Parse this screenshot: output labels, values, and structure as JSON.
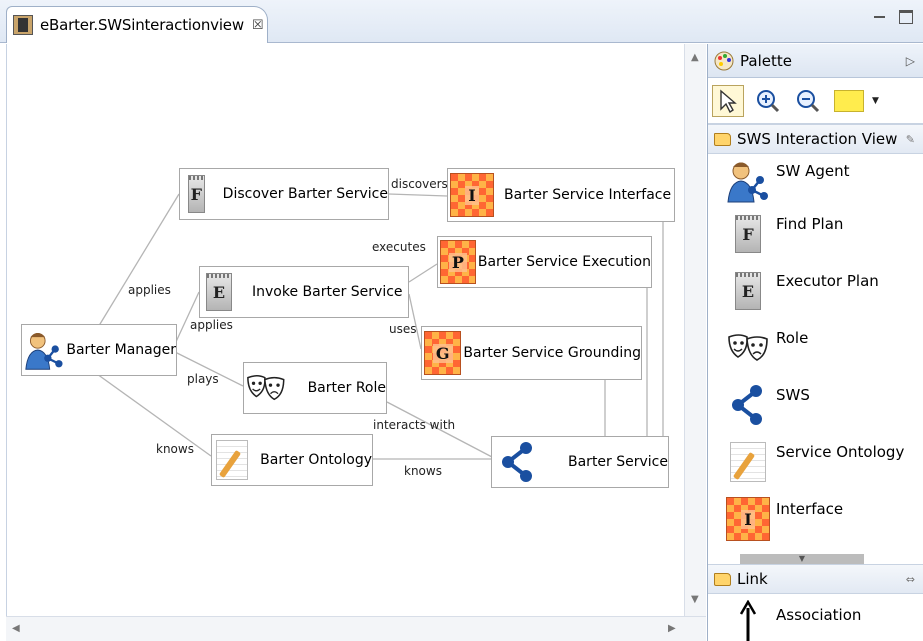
{
  "editor": {
    "tab_title": "eBarter.SWSinteractionview",
    "tab_close": "☒"
  },
  "diagram": {
    "nodes": {
      "barter_manager": "Barter Manager",
      "discover": "Discover Barter Service",
      "interface": "Barter Service Interface",
      "invoke": "Invoke Barter Service",
      "execution": "Barter Service Execution",
      "grounding": "Barter Service Grounding",
      "role": "Barter Role",
      "ontology": "Barter Ontology",
      "service": "Barter Service"
    },
    "icon_letters": {
      "discover": "F",
      "invoke": "E",
      "interface": "I",
      "execution": "P",
      "grounding": "G"
    },
    "edges": {
      "discovers": "discovers",
      "executes": "executes",
      "uses": "uses",
      "applies_top": "applies",
      "applies_bottom": "applies",
      "plays": "plays",
      "interacts_with": "interacts with",
      "knows_left": "knows",
      "knows_bottom": "knows"
    }
  },
  "palette": {
    "title": "Palette",
    "drawer_title": "SWS Interaction View",
    "items": [
      "SW Agent",
      "Find Plan",
      "Executor Plan",
      "Role",
      "SWS",
      "Service Ontology",
      "Interface"
    ],
    "item_letters": {
      "find": "F",
      "exec": "E",
      "iface": "I"
    },
    "link_drawer_title": "Link",
    "link_items": [
      "Association"
    ]
  },
  "colors": {
    "accent": "#1a4fa0",
    "node_border": "#a8a8a8",
    "edge": "#b5b5b5"
  }
}
